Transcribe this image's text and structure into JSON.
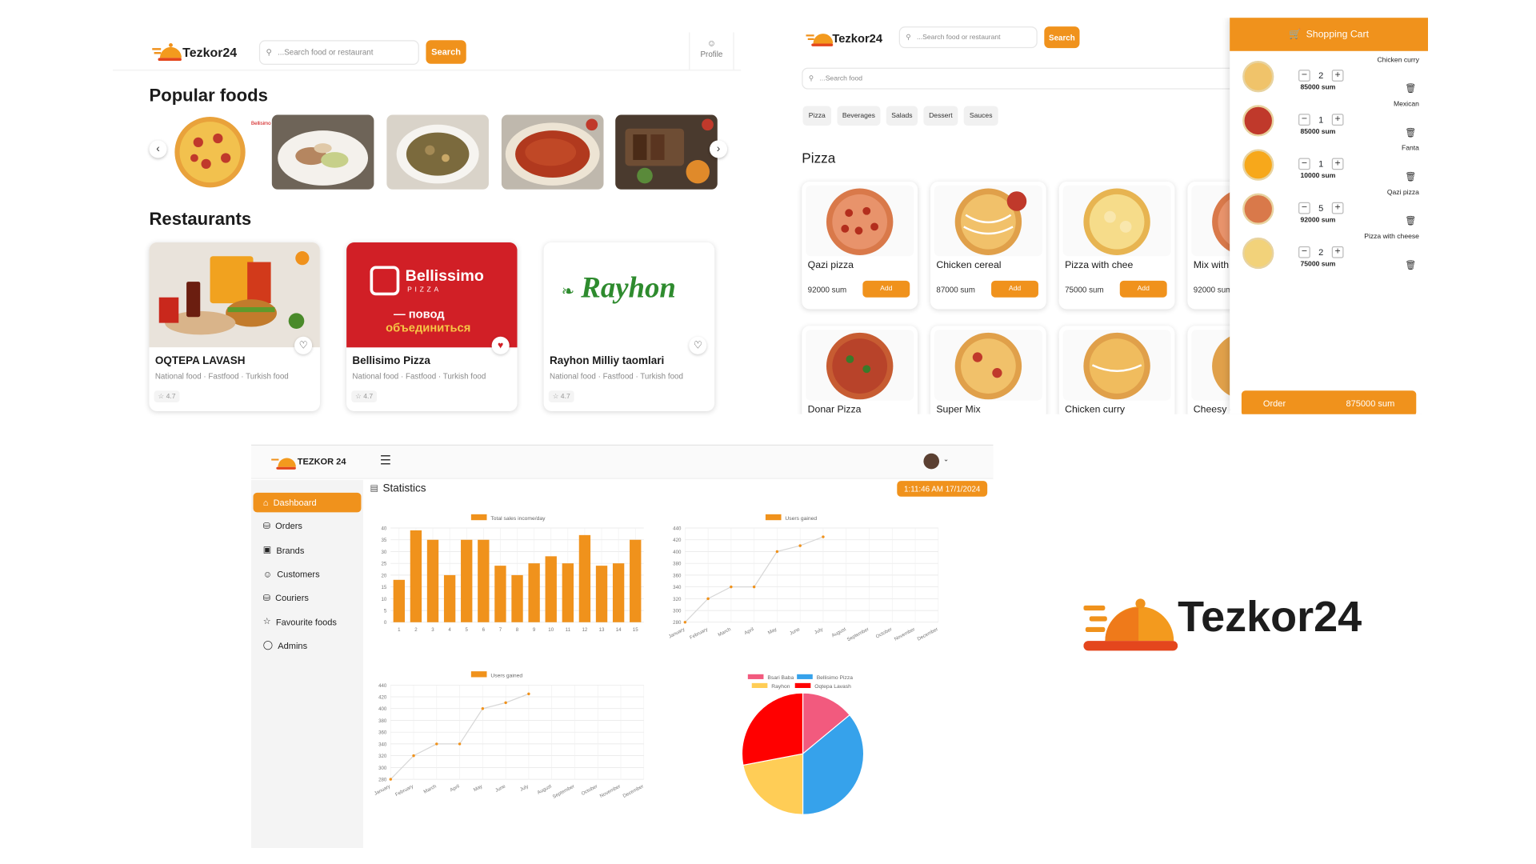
{
  "panel_home": {
    "brand": "Tezkor24",
    "search_placeholder": "...Search food or restaurant",
    "search_button": "Search",
    "profile_label": "Profile",
    "popular_title": "Popular foods",
    "restaurants_title": "Restaurants",
    "restaurants": [
      {
        "name": "OQTEPA LAVASH",
        "categories": "National food · Fastfood · Turkish food",
        "rating": "4.7",
        "favorite": false
      },
      {
        "name": "Bellisimo Pizza",
        "categories": "National food · Fastfood · Turkish food",
        "rating": "4.7",
        "favorite": true
      },
      {
        "name": "Rayhon Milliy taomlari",
        "categories": "National food · Fastfood · Turkish food",
        "rating": "4.7",
        "favorite": false
      }
    ],
    "bellissimo_logo_text": "Bellissimo",
    "bellissimo_sub": "PIZZA",
    "bellissimo_slogan_1": "— повод",
    "bellissimo_slogan_2": "объединиться",
    "rayhon_logo_text": "Rayhon"
  },
  "panel_menu": {
    "brand": "Tezkor24",
    "search_placeholder": "...Search food or restaurant",
    "search_button": "Search",
    "food_search_placeholder": "...Search food",
    "categories": [
      "Pizza",
      "Beverages",
      "Salads",
      "Dessert",
      "Sauces"
    ],
    "section_title": "Pizza",
    "add_label": "Add",
    "pizzas": [
      {
        "name": "Qazi pizza",
        "price": "92000 sum"
      },
      {
        "name": "Chicken cereal",
        "price": "87000 sum"
      },
      {
        "name": "Pizza with chee",
        "price": "75000 sum"
      },
      {
        "name": "Mix with",
        "price": "92000 sum"
      },
      {
        "name": "Donar Pizza",
        "price": ""
      },
      {
        "name": "Super Mix",
        "price": ""
      },
      {
        "name": "Chicken curry",
        "price": ""
      },
      {
        "name": "Cheesy c",
        "price": ""
      }
    ]
  },
  "cart": {
    "title": "Shopping Cart",
    "items": [
      {
        "name": "Chicken curry",
        "qty": "2",
        "price": "85000 sum"
      },
      {
        "name": "Mexican",
        "qty": "1",
        "price": "85000 sum"
      },
      {
        "name": "Fanta",
        "qty": "1",
        "price": "10000 sum"
      },
      {
        "name": "Qazi pizza",
        "qty": "5",
        "price": "92000 sum"
      },
      {
        "name": "Pizza with cheese",
        "qty": "2",
        "price": "75000 sum"
      }
    ],
    "order_label": "Order",
    "order_total": "875000 sum"
  },
  "dashboard": {
    "brand": "TEZKOR 24",
    "title": "Statistics",
    "datetime": "1:11:46 AM 17/1/2024",
    "menu": [
      "Dashboard",
      "Orders",
      "Brands",
      "Customers",
      "Couriers",
      "Favourite foods",
      "Admins"
    ],
    "active_menu": "Dashboard"
  },
  "big_logo": {
    "text": "Tezkor24"
  },
  "colors": {
    "accent": "#f0921c",
    "dark": "#1b1b1b",
    "red": "#d11f26",
    "green": "#2e8b2e"
  },
  "chart_data": [
    {
      "type": "bar",
      "legend": "Total sales income/day",
      "categories": [
        "1",
        "2",
        "3",
        "4",
        "5",
        "6",
        "7",
        "8",
        "9",
        "10",
        "11",
        "12",
        "13",
        "14",
        "15"
      ],
      "values": [
        18,
        39,
        35,
        20,
        35,
        35,
        24,
        20,
        25,
        28,
        25,
        37,
        24,
        25,
        35
      ],
      "ylim": [
        0,
        40
      ],
      "yticks": [
        "0",
        "5",
        "10",
        "15",
        "20",
        "25",
        "30",
        "35",
        "40"
      ],
      "grid": true
    },
    {
      "type": "line",
      "legend": "Users gained",
      "categories": [
        "January",
        "February",
        "March",
        "April",
        "May",
        "June",
        "July",
        "August",
        "September",
        "October",
        "November",
        "December"
      ],
      "values": [
        280,
        320,
        340,
        340,
        400,
        410,
        425
      ],
      "ylim": [
        280,
        440
      ],
      "yticks": [
        "280",
        "300",
        "320",
        "340",
        "360",
        "380",
        "400",
        "420",
        "440"
      ],
      "grid": true
    },
    {
      "type": "line",
      "legend": "Users gained",
      "categories": [
        "January",
        "February",
        "March",
        "April",
        "May",
        "June",
        "July",
        "August",
        "September",
        "October",
        "November",
        "December"
      ],
      "values": [
        280,
        320,
        340,
        340,
        400,
        410,
        425
      ],
      "ylim": [
        280,
        440
      ],
      "yticks": [
        "280",
        "300",
        "320",
        "340",
        "360",
        "380",
        "400",
        "420",
        "440"
      ],
      "grid": true
    },
    {
      "type": "pie",
      "series": [
        {
          "name": "Bsari Baba",
          "value": 14,
          "color": "#f25a7e"
        },
        {
          "name": "Bellisimo Pizza",
          "value": 36,
          "color": "#36a2eb"
        },
        {
          "name": "Rayhon",
          "value": 22,
          "color": "#ffcd56"
        },
        {
          "name": "Oqtepa Lavash",
          "value": 28,
          "color": "#ff0000"
        }
      ]
    }
  ]
}
